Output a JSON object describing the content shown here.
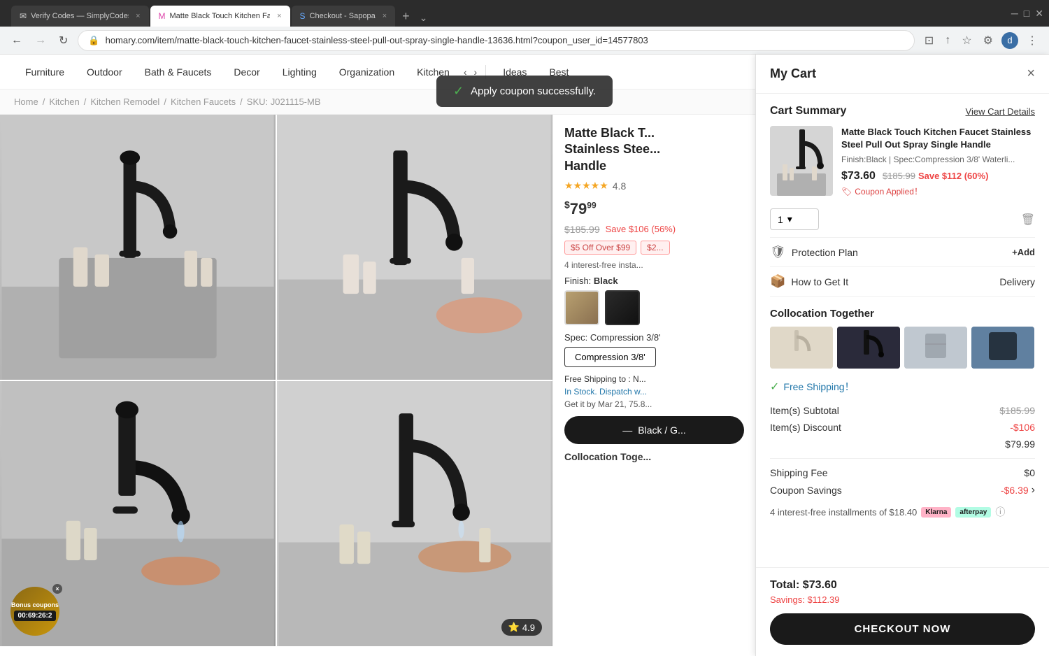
{
  "browser": {
    "tabs": [
      {
        "id": "tab1",
        "label": "Verify Codes — SimplyCodes",
        "active": false,
        "favicon": "✉"
      },
      {
        "id": "tab2",
        "label": "Matte Black Touch Kitchen Faucet St...",
        "active": true,
        "favicon": "M"
      },
      {
        "id": "tab3",
        "label": "Checkout - Sapopa",
        "active": false,
        "favicon": "S"
      }
    ],
    "url": "homary.com/item/matte-black-touch-kitchen-faucet-stainless-steel-pull-out-spray-single-handle-13636.html?coupon_user_id=14577803",
    "new_tab_label": "+",
    "tab_overflow": "⌄"
  },
  "nav": {
    "items": [
      {
        "id": "furniture",
        "label": "Furniture"
      },
      {
        "id": "outdoor",
        "label": "Outdoor"
      },
      {
        "id": "bath-faucets",
        "label": "Bath & Faucets"
      },
      {
        "id": "decor",
        "label": "Decor"
      },
      {
        "id": "lighting",
        "label": "Lighting"
      },
      {
        "id": "organization",
        "label": "Organization"
      },
      {
        "id": "kitchen",
        "label": "Kitchen"
      },
      {
        "id": "ideas",
        "label": "Ideas"
      },
      {
        "id": "best",
        "label": "Best"
      }
    ]
  },
  "breadcrumb": {
    "items": [
      "Home",
      "Kitchen",
      "Kitchen Remodel",
      "Kitchen Faucets",
      "SKU: J021115-MB"
    ]
  },
  "product": {
    "title": "Matte Black Touch Kitchen Faucet Stainless Steel Single Handle",
    "title_short": "Matte Black T... Stainless Stee... Handle",
    "rating": "4.8",
    "stars": "★★★★★",
    "price": "79",
    "price_cents": "99",
    "original_price": "$185.99",
    "save_text": "Save $106 (56%)",
    "promo_tags": [
      "$5 Off Over $99",
      "$2..."
    ],
    "installments_text": "4 interest-free insta...",
    "finish_label": "Finish:",
    "finish_value": "Black",
    "spec_label": "Spec:",
    "spec_value": "Compression 3/8'",
    "spec_btn_label": "Compression 3/8'",
    "shipping_label": "Free Shipping to : N...",
    "stock_label": "In Stock. Dispatch w...",
    "delivery_label": "Get it by Mar 21, 75.8...",
    "add_to_cart_label": "Black / G...",
    "collocation_title": "Collocation Toge...",
    "rating_badge": "4.9"
  },
  "bonus": {
    "label": "Bonus coupons",
    "timer": "00:69:26:2",
    "close": "×"
  },
  "toast": {
    "message": "Apply coupon successfully.",
    "check": "✓"
  },
  "cart": {
    "title": "My Cart",
    "close_icon": "×",
    "summary_title": "Cart Summary",
    "view_cart_label": "View Cart Details",
    "item": {
      "name": "Matte Black Touch Kitchen Faucet Stainless Steel Pull Out Spray Single Handle",
      "spec": "Finish:Black | Spec:Compression 3/8' Waterli...",
      "price": "$73.60",
      "original_price": "$185.99",
      "save_label": "Save $112 (60%)",
      "coupon_applied": "Coupon Applied！",
      "qty": "1"
    },
    "qty_dropdown_icon": "▾",
    "delete_icon": "🗑",
    "protection": {
      "label": "Protection Plan",
      "add_label": "+Add",
      "icon": "🛡"
    },
    "delivery": {
      "label": "How to Get It",
      "value": "Delivery",
      "icon": "📦"
    },
    "collocation": {
      "title": "Collocation Together"
    },
    "free_shipping": "Free Shipping！",
    "subtotal_label": "Item(s) Subtotal",
    "subtotal_orig": "$185.99",
    "discount_label": "Item(s) Discount",
    "discount_value": "-$106",
    "subtotal_value": "$79.99",
    "shipping_label": "Shipping Fee",
    "shipping_value": "$0",
    "coupon_label": "Coupon Savings",
    "coupon_value": "-$6.39",
    "installments_text": "4 interest-free installments of $18.40",
    "total_label": "Total: $73.60",
    "savings_label": "Savings: $112.39",
    "checkout_label": "CHECKOUT NOW"
  }
}
